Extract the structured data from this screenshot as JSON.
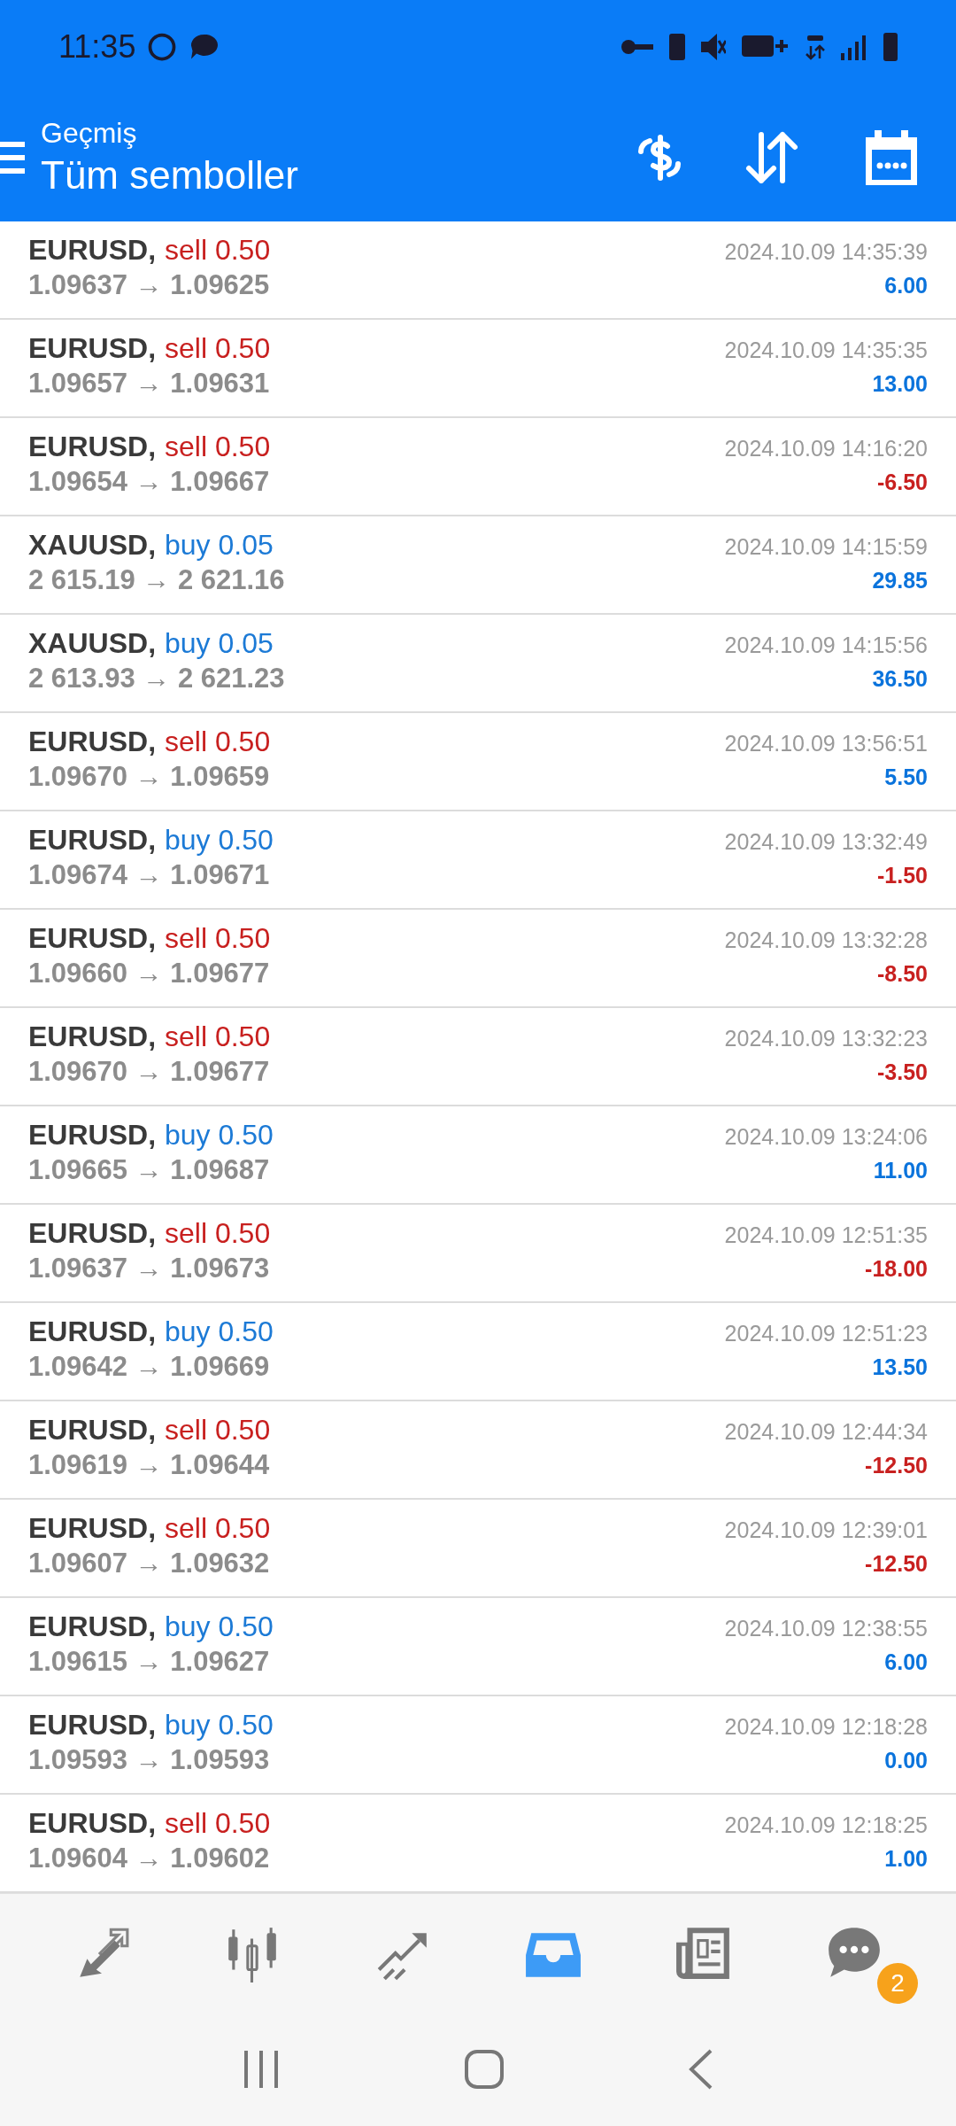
{
  "status_bar": {
    "time": "11:35"
  },
  "header": {
    "subtitle": "Geçmiş",
    "title": "Tüm semboller"
  },
  "trades": [
    {
      "symbol": "EURUSD,",
      "side": "sell 0.50",
      "kind": "sell",
      "prices": "1.09637 → 1.09625",
      "time": "2024.10.09 14:35:39",
      "profit": "6.00",
      "loss": false
    },
    {
      "symbol": "EURUSD,",
      "side": "sell 0.50",
      "kind": "sell",
      "prices": "1.09657 → 1.09631",
      "time": "2024.10.09 14:35:35",
      "profit": "13.00",
      "loss": false
    },
    {
      "symbol": "EURUSD,",
      "side": "sell 0.50",
      "kind": "sell",
      "prices": "1.09654 → 1.09667",
      "time": "2024.10.09 14:16:20",
      "profit": "-6.50",
      "loss": true
    },
    {
      "symbol": "XAUUSD,",
      "side": "buy 0.05",
      "kind": "buy",
      "prices": "2 615.19 → 2 621.16",
      "time": "2024.10.09 14:15:59",
      "profit": "29.85",
      "loss": false
    },
    {
      "symbol": "XAUUSD,",
      "side": "buy 0.05",
      "kind": "buy",
      "prices": "2 613.93 → 2 621.23",
      "time": "2024.10.09 14:15:56",
      "profit": "36.50",
      "loss": false
    },
    {
      "symbol": "EURUSD,",
      "side": "sell 0.50",
      "kind": "sell",
      "prices": "1.09670 → 1.09659",
      "time": "2024.10.09 13:56:51",
      "profit": "5.50",
      "loss": false
    },
    {
      "symbol": "EURUSD,",
      "side": "buy 0.50",
      "kind": "buy",
      "prices": "1.09674 → 1.09671",
      "time": "2024.10.09 13:32:49",
      "profit": "-1.50",
      "loss": true
    },
    {
      "symbol": "EURUSD,",
      "side": "sell 0.50",
      "kind": "sell",
      "prices": "1.09660 → 1.09677",
      "time": "2024.10.09 13:32:28",
      "profit": "-8.50",
      "loss": true
    },
    {
      "symbol": "EURUSD,",
      "side": "sell 0.50",
      "kind": "sell",
      "prices": "1.09670 → 1.09677",
      "time": "2024.10.09 13:32:23",
      "profit": "-3.50",
      "loss": true
    },
    {
      "symbol": "EURUSD,",
      "side": "buy 0.50",
      "kind": "buy",
      "prices": "1.09665 → 1.09687",
      "time": "2024.10.09 13:24:06",
      "profit": "11.00",
      "loss": false
    },
    {
      "symbol": "EURUSD,",
      "side": "sell 0.50",
      "kind": "sell",
      "prices": "1.09637 → 1.09673",
      "time": "2024.10.09 12:51:35",
      "profit": "-18.00",
      "loss": true
    },
    {
      "symbol": "EURUSD,",
      "side": "buy 0.50",
      "kind": "buy",
      "prices": "1.09642 → 1.09669",
      "time": "2024.10.09 12:51:23",
      "profit": "13.50",
      "loss": false
    },
    {
      "symbol": "EURUSD,",
      "side": "sell 0.50",
      "kind": "sell",
      "prices": "1.09619 → 1.09644",
      "time": "2024.10.09 12:44:34",
      "profit": "-12.50",
      "loss": true
    },
    {
      "symbol": "EURUSD,",
      "side": "sell 0.50",
      "kind": "sell",
      "prices": "1.09607 → 1.09632",
      "time": "2024.10.09 12:39:01",
      "profit": "-12.50",
      "loss": true
    },
    {
      "symbol": "EURUSD,",
      "side": "buy 0.50",
      "kind": "buy",
      "prices": "1.09615 → 1.09627",
      "time": "2024.10.09 12:38:55",
      "profit": "6.00",
      "loss": false
    },
    {
      "symbol": "EURUSD,",
      "side": "buy 0.50",
      "kind": "buy",
      "prices": "1.09593 → 1.09593",
      "time": "2024.10.09 12:18:28",
      "profit": "0.00",
      "loss": false
    },
    {
      "symbol": "EURUSD,",
      "side": "sell 0.50",
      "kind": "sell",
      "prices": "1.09604 → 1.09602",
      "time": "2024.10.09 12:18:25",
      "profit": "1.00",
      "loss": false
    }
  ],
  "bottom_nav": [
    {
      "kind": "quotes",
      "selected": false
    },
    {
      "kind": "chart",
      "selected": false
    },
    {
      "kind": "trade",
      "selected": false
    },
    {
      "kind": "history",
      "selected": true
    },
    {
      "kind": "news",
      "selected": false
    },
    {
      "kind": "messages",
      "selected": false,
      "badge": "2"
    }
  ]
}
